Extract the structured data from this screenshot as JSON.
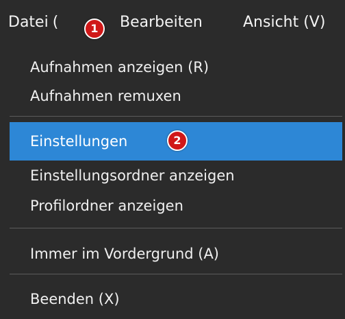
{
  "menubar": {
    "file_label": "Datei",
    "file_hotkey_fragment": "(",
    "edit_label": "Bearbeiten",
    "view_label": "Ansicht (V)"
  },
  "file_menu": {
    "items": [
      {
        "label": "Aufnahmen anzeigen (R)"
      },
      {
        "label": "Aufnahmen remuxen"
      },
      {
        "label": "Einstellungen"
      },
      {
        "label": "Einstellungsordner anzeigen"
      },
      {
        "label": "Profilordner anzeigen"
      },
      {
        "label": "Immer im Vordergrund (A)"
      },
      {
        "label": "Beenden (X)"
      }
    ],
    "selected_label": "Einstellungen"
  },
  "callouts": [
    {
      "number": "1"
    },
    {
      "number": "2"
    }
  ],
  "colors": {
    "menu_background": "#2b2b2b",
    "selection": "#2d87d6",
    "separator": "#5c5c5c",
    "callout_badge": "#d01818"
  }
}
